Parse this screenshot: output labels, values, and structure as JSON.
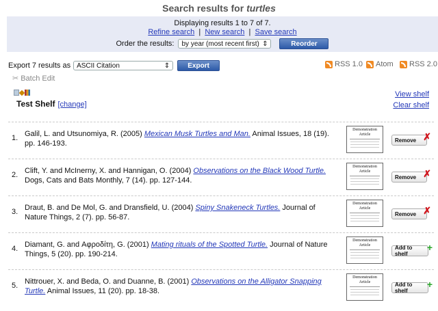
{
  "header": {
    "title_prefix": "Search results for ",
    "query": "turtles"
  },
  "summary": {
    "displaying": "Displaying results 1 to 7 of 7.",
    "links": [
      "Refine search",
      "New search",
      "Save search"
    ],
    "order_label": "Order the results:",
    "order_value": "by year (most recent first)",
    "reorder_label": "Reorder"
  },
  "export": {
    "label": "Export 7 results as",
    "format": "ASCII Citation",
    "button": "Export"
  },
  "feeds": [
    "RSS 1.0",
    "Atom",
    "RSS 2.0"
  ],
  "batch_edit": "Batch Edit",
  "shelf": {
    "name": "Test Shelf",
    "change": "[change]",
    "view": "View shelf",
    "clear": "Clear shelf"
  },
  "thumb_text": "Demonstration Article",
  "results": [
    {
      "num": "1.",
      "pre": "Galil, L. and Utsunomiya, R. (2005) ",
      "title": "Mexican Musk Turtles and Man.",
      "post": " Animal Issues, 18 (19). pp. 146-193.",
      "action": "Remove"
    },
    {
      "num": "2.",
      "pre": "Clift, Y. and McInerny, X. and Hannigan, O. (2004) ",
      "title": "Observations on the Black Wood Turtle.",
      "post": " Dogs, Cats and Bats Monthly, 7 (14). pp. 127-144.",
      "action": "Remove"
    },
    {
      "num": "3.",
      "pre": "Draut, B. and De Mol, G. and Dransfield, U. (2004) ",
      "title": "Spiny Snakeneck Turtles.",
      "post": " Journal of Nature Things, 2 (7). pp. 56-87.",
      "action": "Remove"
    },
    {
      "num": "4.",
      "pre": "Diamant, G. and Αφροδίτη, G. (2001) ",
      "title": "Mating rituals of the Spotted Turtle.",
      "post": " Journal of Nature Things, 5 (20). pp. 190-214.",
      "action": "Add to shelf"
    },
    {
      "num": "5.",
      "pre": "Nittrouer, X. and Beda, O. and Duanne, B. (2001) ",
      "title": "Observations on the Alligator Snapping Turtle.",
      "post": " Animal Issues, 11 (20). pp. 18-38.",
      "action": "Add to shelf"
    }
  ],
  "colors": {
    "accent": "#2237b8",
    "remove": "#d0131b",
    "add": "#2aa52a",
    "summary_bg": "#e7eaf5"
  }
}
